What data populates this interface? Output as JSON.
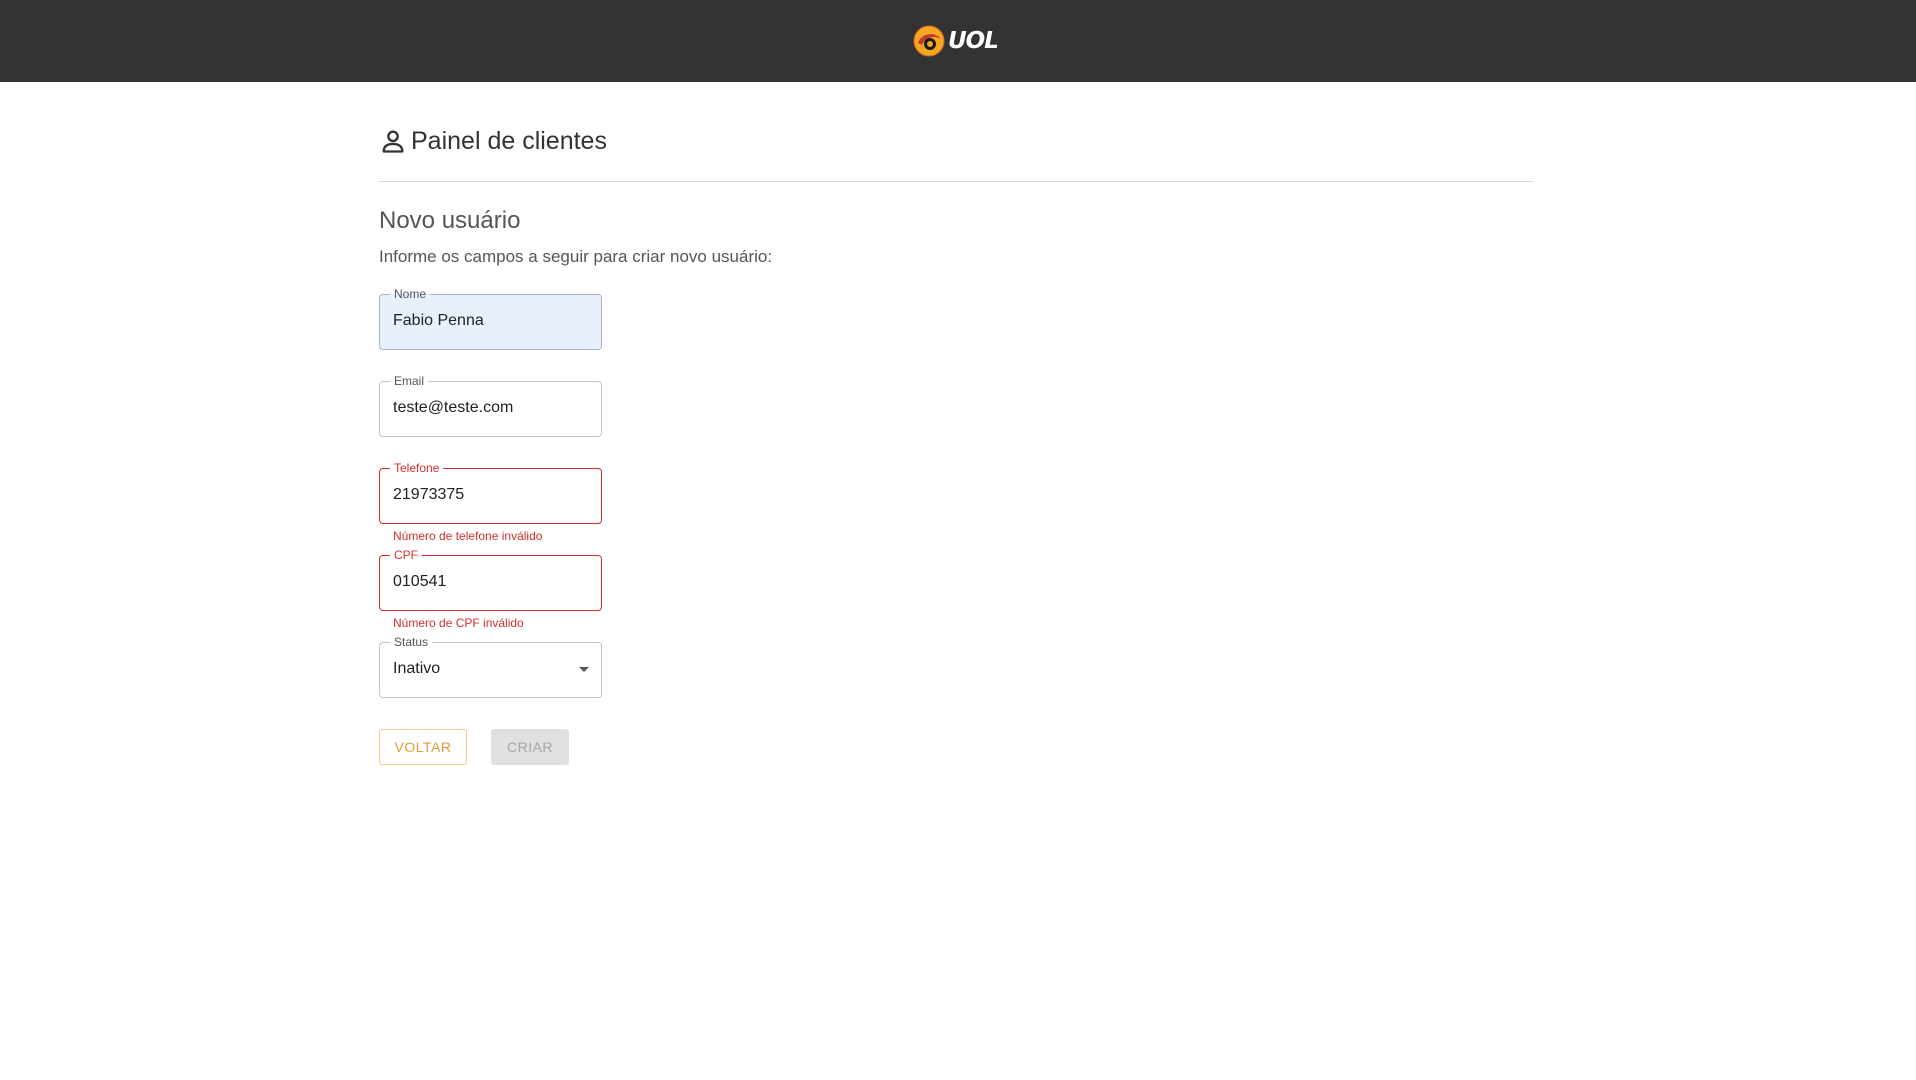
{
  "header": {
    "logo_text": "UOL",
    "logo_icon": "uol-logo-icon",
    "background_color": "#333333"
  },
  "panel": {
    "title": "Painel de clientes",
    "icon": "person-outline-icon"
  },
  "form": {
    "title": "Novo usuário",
    "description": "Informe os campos a seguir para criar novo usuário:",
    "fields": {
      "nome": {
        "label": "Nome",
        "value": "Fabio Penna"
      },
      "email": {
        "label": "Email",
        "value": "teste@teste.com"
      },
      "telefone": {
        "label": "Telefone",
        "value": "21973375",
        "error": "Número de telefone inválido"
      },
      "cpf": {
        "label": "CPF",
        "value": "010541",
        "error": "Número de CPF inválido"
      },
      "status": {
        "label": "Status",
        "value": "Inativo"
      }
    },
    "buttons": {
      "back_label": "VOLTAR",
      "create_label": "CRIAR"
    }
  },
  "colors": {
    "accent": "#e69a3a",
    "error": "#d32f2f",
    "autofill": "#e8f0fe"
  }
}
